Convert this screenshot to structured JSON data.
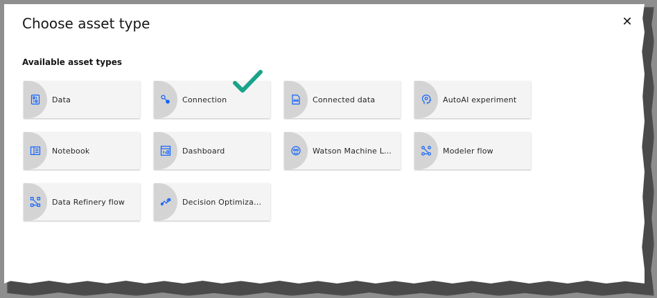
{
  "dialog": {
    "title": "Choose asset type",
    "close_label": "✕",
    "section_label": "Available asset types"
  },
  "tiles": [
    {
      "label": "Data",
      "icon": "data-icon"
    },
    {
      "label": "Connection",
      "icon": "connection-icon"
    },
    {
      "label": "Connected data",
      "icon": "connected-data-icon"
    },
    {
      "label": "AutoAI experiment",
      "icon": "autoai-icon"
    },
    {
      "label": "Notebook",
      "icon": "notebook-icon"
    },
    {
      "label": "Dashboard",
      "icon": "dashboard-icon"
    },
    {
      "label": "Watson Machine Le...",
      "icon": "machine-learning-icon"
    },
    {
      "label": "Modeler flow",
      "icon": "modeler-flow-icon"
    },
    {
      "label": "Data Refinery flow",
      "icon": "data-refinery-icon"
    },
    {
      "label": "Decision Optimizati...",
      "icon": "decision-optimization-icon"
    }
  ],
  "colors": {
    "icon_blue": "#0f62fe",
    "check_green": "#1aa38b",
    "tile_bg": "#f4f4f4"
  }
}
